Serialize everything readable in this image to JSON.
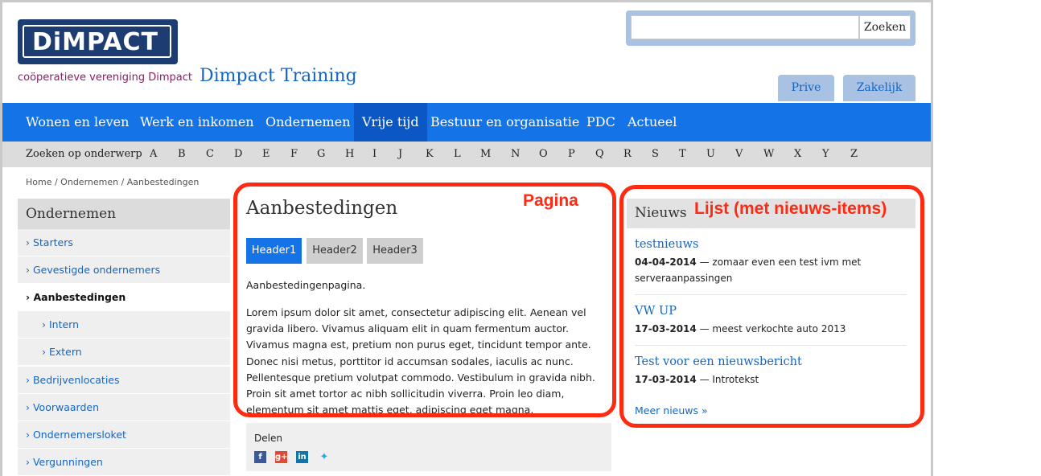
{
  "header": {
    "logo_text": "DiMPACT",
    "logo_subtitle": "coöperatieve vereniging Dimpact",
    "site_title": "Dimpact Training",
    "search_placeholder": "",
    "search_button": "Zoeken",
    "tabs": [
      {
        "label": "Prive"
      },
      {
        "label": "Zakelijk"
      }
    ]
  },
  "mainnav": {
    "items": [
      {
        "label": "Wonen en leven",
        "active": false
      },
      {
        "label": "Werk en inkomen",
        "active": false
      },
      {
        "label": "Ondernemen",
        "active": false
      },
      {
        "label": "Vrije tijd",
        "active": true
      },
      {
        "label": "Bestuur en organisatie",
        "active": false
      },
      {
        "label": "PDC",
        "active": false
      },
      {
        "label": "Actueel",
        "active": false
      }
    ]
  },
  "letterbar": {
    "label": "Zoeken op onderwerp",
    "letters": [
      "A",
      "B",
      "C",
      "D",
      "E",
      "F",
      "G",
      "H",
      "I",
      "J",
      "K",
      "L",
      "M",
      "N",
      "O",
      "P",
      "Q",
      "R",
      "S",
      "T",
      "U",
      "V",
      "W",
      "X",
      "Y",
      "Z"
    ]
  },
  "breadcrumb": "Home / Ondernemen / Aanbestedingen",
  "sidebar": {
    "heading": "Ondernemen",
    "items": [
      {
        "label": "› Starters"
      },
      {
        "label": "› Gevestigde ondernemers"
      },
      {
        "label": "› Aanbestedingen"
      },
      {
        "label": "› Intern"
      },
      {
        "label": "› Extern"
      },
      {
        "label": "› Bedrijvenlocaties"
      },
      {
        "label": "› Voorwaarden"
      },
      {
        "label": "› Ondernemersloket"
      },
      {
        "label": "› Vergunningen"
      }
    ]
  },
  "content": {
    "title": "Aanbestedingen",
    "header_buttons": [
      "Header1",
      "Header2",
      "Header3"
    ],
    "intro": "Aanbestedingenpagina.",
    "lorem": "Lorem ipsum dolor sit amet, consectetur adipiscing elit. Aenean vel gravida libero. Vivamus aliquam elit in quam fermentum auctor. Vivamus magna est, pretium non purus eget, tincidunt tempor ante. Donec nisi metus, porttitor id accumsan sodales, iaculis ac nunc. Pellentesque pretium volutpat commodo. Vestibulum in gravida nibh. Proin sit amet tortor ac nibh sollicitudin viverra. Proin leo diam, elementum sit amet mattis eget, adipiscing eget magna.",
    "share_label": "Delen",
    "share_icons": [
      "facebook-icon",
      "google-plus-icon",
      "linkedin-icon",
      "twitter-icon"
    ]
  },
  "news": {
    "heading": "Nieuws",
    "items": [
      {
        "title": "testnieuws",
        "date": "04-04-2014",
        "text": " — zomaar even een test ivm met serveraanpassingen"
      },
      {
        "title": "VW UP",
        "date": "17-03-2014",
        "text": " — meest verkochte auto 2013"
      },
      {
        "title": "Test voor een nieuwsbericht",
        "date": "17-03-2014",
        "text": " — Introtekst"
      }
    ],
    "more_label": "Meer nieuws »"
  },
  "annotations": {
    "pagina": "Pagina",
    "lijst": "Lijst (met nieuws-items)"
  },
  "colors": {
    "brand_blue": "#1473e6",
    "nav_active": "#0b57c4",
    "link": "#1565c0",
    "logo_bg": "#1d3c72",
    "annotation_red": "#ff2a12"
  }
}
